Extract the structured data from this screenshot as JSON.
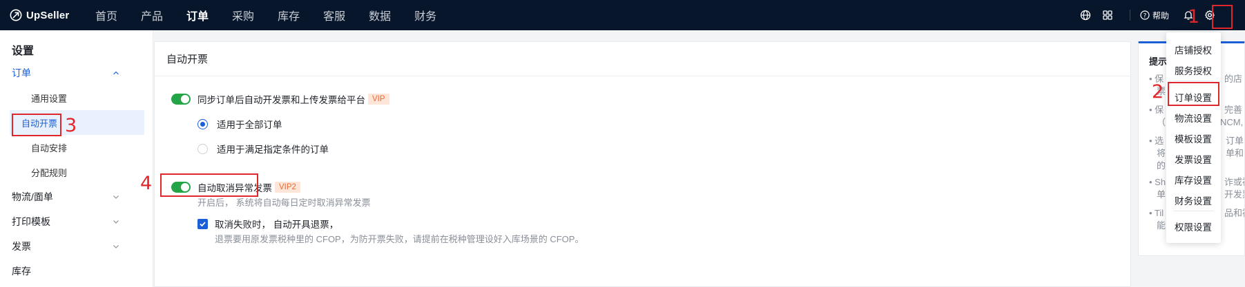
{
  "app": {
    "logo_text": "UpSeller"
  },
  "nav": {
    "items": [
      {
        "label": "首页"
      },
      {
        "label": "产品"
      },
      {
        "label": "订单"
      },
      {
        "label": "采购"
      },
      {
        "label": "库存"
      },
      {
        "label": "客服"
      },
      {
        "label": "数据"
      },
      {
        "label": "财务"
      }
    ],
    "active": "订单",
    "help_label": "帮助"
  },
  "sidebar": {
    "title": "设置",
    "groups": [
      {
        "label": "订单",
        "expanded": true,
        "items": [
          {
            "label": "通用设置"
          },
          {
            "label": "自动开票"
          },
          {
            "label": "自动安排"
          },
          {
            "label": "分配规则"
          }
        ]
      },
      {
        "label": "物流/面单"
      },
      {
        "label": "打印模板"
      },
      {
        "label": "发票"
      },
      {
        "label": "库存"
      }
    ]
  },
  "main": {
    "title": "自动开票",
    "sync_toggle": {
      "label": "同步订单后自动开发票和上传发票给平台",
      "badge": "VIP",
      "on": true
    },
    "radio_all": {
      "label": "适用于全部订单",
      "checked": true
    },
    "radio_cond": {
      "label": "适用于满足指定条件的订单",
      "checked": false
    },
    "cancel_toggle": {
      "label": "自动取消异常发票",
      "badge": "VIP2",
      "on": true
    },
    "cancel_hint": "开启后， 系统将自动每日定时取消异常发票",
    "refund_check": {
      "label": "取消失败时， 自动开具退票，",
      "checked": true
    },
    "refund_hint": "退票要用原发票税种里的 CFOP，为防开票失败，请提前在税种管理设好入库场景的 CFOP。"
  },
  "tips": {
    "title": "提示",
    "lines": [
      "• 保",
      "票",
      "• 保",
      "（",
      "• 选",
      "将",
      "的",
      "• Sh",
      "单",
      "• Til",
      "能"
    ],
    "right_lines": [
      "的店",
      "完善",
      "NCM,",
      "订单",
      "单和",
      "诈或被",
      "开发票",
      "品和被"
    ]
  },
  "dropdown": {
    "items": [
      {
        "label": "店铺授权"
      },
      {
        "label": "服务授权"
      },
      {
        "label": "订单设置"
      },
      {
        "label": "物流设置"
      },
      {
        "label": "模板设置"
      },
      {
        "label": "发票设置"
      },
      {
        "label": "库存设置"
      },
      {
        "label": "财务设置"
      },
      {
        "label": "权限设置"
      }
    ]
  },
  "annotations": {
    "color": "#e0262a",
    "labels": [
      "1",
      "2",
      "3",
      "4"
    ]
  },
  "colors": {
    "topbar": "#07162b",
    "accent": "#1a5fd8",
    "toggle_on": "#22a447",
    "vip_bg": "#fde5d7",
    "vip_text": "#ea6b35"
  }
}
